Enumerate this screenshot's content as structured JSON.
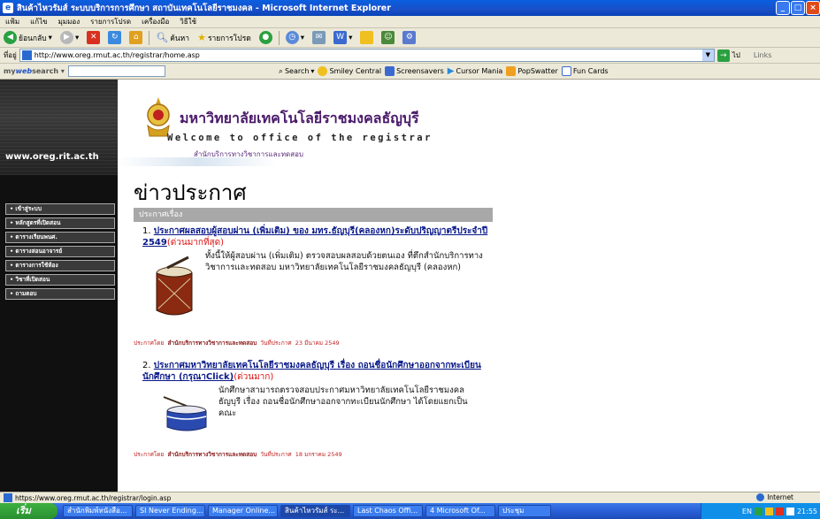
{
  "window": {
    "title": "สินค้าไหวรัมส์ ระบบบริการการศึกษา สถาบันเทคโนโลยีราชมงคล - Microsoft Internet Explorer"
  },
  "menu": [
    "แฟ้ม",
    "แก้ไข",
    "มุมมอง",
    "รายการโปรด",
    "เครื่องมือ",
    "วิธีใช้"
  ],
  "toolbar": {
    "back": "ย้อนกลับ",
    "search": "ค้นหา",
    "favorites": "รายการโปรด"
  },
  "address": {
    "label": "ที่อยู่",
    "url": "http://www.oreg.rmut.ac.th/registrar/home.asp",
    "go": "ไป",
    "links": "Links"
  },
  "searchbar": {
    "brand_a": "my",
    "brand_b": "web",
    "brand_c": "search",
    "items": [
      "Search",
      "Smiley Central",
      "Screensavers",
      "Cursor Mania",
      "PopSwatter",
      "Fun Cards"
    ]
  },
  "sidebar": {
    "site": "www.oreg.rit.ac.th",
    "items": [
      "เข้าสู่ระบบ",
      "หลักสูตรที่เปิดสอน",
      "ตารางเรียนพนศ.",
      "ตารางสอนอาจารย์",
      "ตารางการใช้ห้อง",
      "วิชาที่เปิดสอน",
      "ถามตอบ"
    ]
  },
  "header": {
    "university": "มหาวิทยาลัยเทคโนโลยีราชมงคลธัญบุรี",
    "welcome": "Welcome to office of the registrar",
    "office": "สำนักบริการทางวิชาการและทดสอบ"
  },
  "page": {
    "title": "ข่าวประกาศ",
    "ribbon": "ประกาศเรื่อง"
  },
  "news": [
    {
      "num": "1.",
      "title": "ประกาศผลสอบผู้สอบผ่าน (เพิ่มเติม) ของ มทร.ธัญบุรี(คลองหก)ระดับปริญญาตรีประจำปี 2549",
      "urgency": "(ด่วนมากที่สุด)",
      "desc": "ทั้งนี้ให้ผู้สอบผ่าน (เพิ่มเติม) ตรวจสอบผลสอบด้วยตนเอง ที่ตึกสำนักบริการทางวิชาการและทดสอบ มหาวิทยาลัยเทคโนโลยีราชมงคลธัญบุรี (คลองหก)",
      "by_label": "ประกาศโดย",
      "by": "สำนักบริการทางวิชาการและทดสอบ",
      "date_label": "วันที่ประกาศ",
      "date": "23 มีนาคม 2549"
    },
    {
      "num": "2.",
      "title": "ประกาศมหาวิทยาลัยเทคโนโลยีราชมงคลธัญบุรี เรื่อง ถอนชื่อนักศึกษาออกจากทะเบียนนักศึกษา (กรุณาClick)",
      "urgency": "(ด่วนมาก)",
      "desc": "นักศึกษาสามารถตรวจสอบประกาศมหาวิทยาลัยเทคโนโลยีราชมงคลธัญบุรี เรื่อง ถอนชื่อนักศึกษาออกจากทะเบียนนักศึกษา ได้โดยแยกเป็นคณะ",
      "by_label": "ประกาศโดย",
      "by": "สำนักบริการทางวิชาการและทดสอบ",
      "date_label": "วันที่ประกาศ",
      "date": "18 มกราคม 2549"
    }
  ],
  "status": {
    "url": "https://www.oreg.rmut.ac.th/registrar/login.asp",
    "zone": "Internet"
  },
  "taskbar": {
    "start": "เริ่ม",
    "tasks": [
      "สำนักพิมพ์หนังสือ...",
      "SI Never Ending...",
      "Manager Online...",
      "สินค้าไหวรัมส์ ระ...",
      "Last Chaos Offi...",
      "4 Microsoft Of...",
      "ประชุม"
    ],
    "lang": "EN",
    "clock": "21:55"
  },
  "colors": {
    "accent": "#0a1a8a",
    "urgent": "#e01010",
    "purple": "#4a1a6a"
  }
}
